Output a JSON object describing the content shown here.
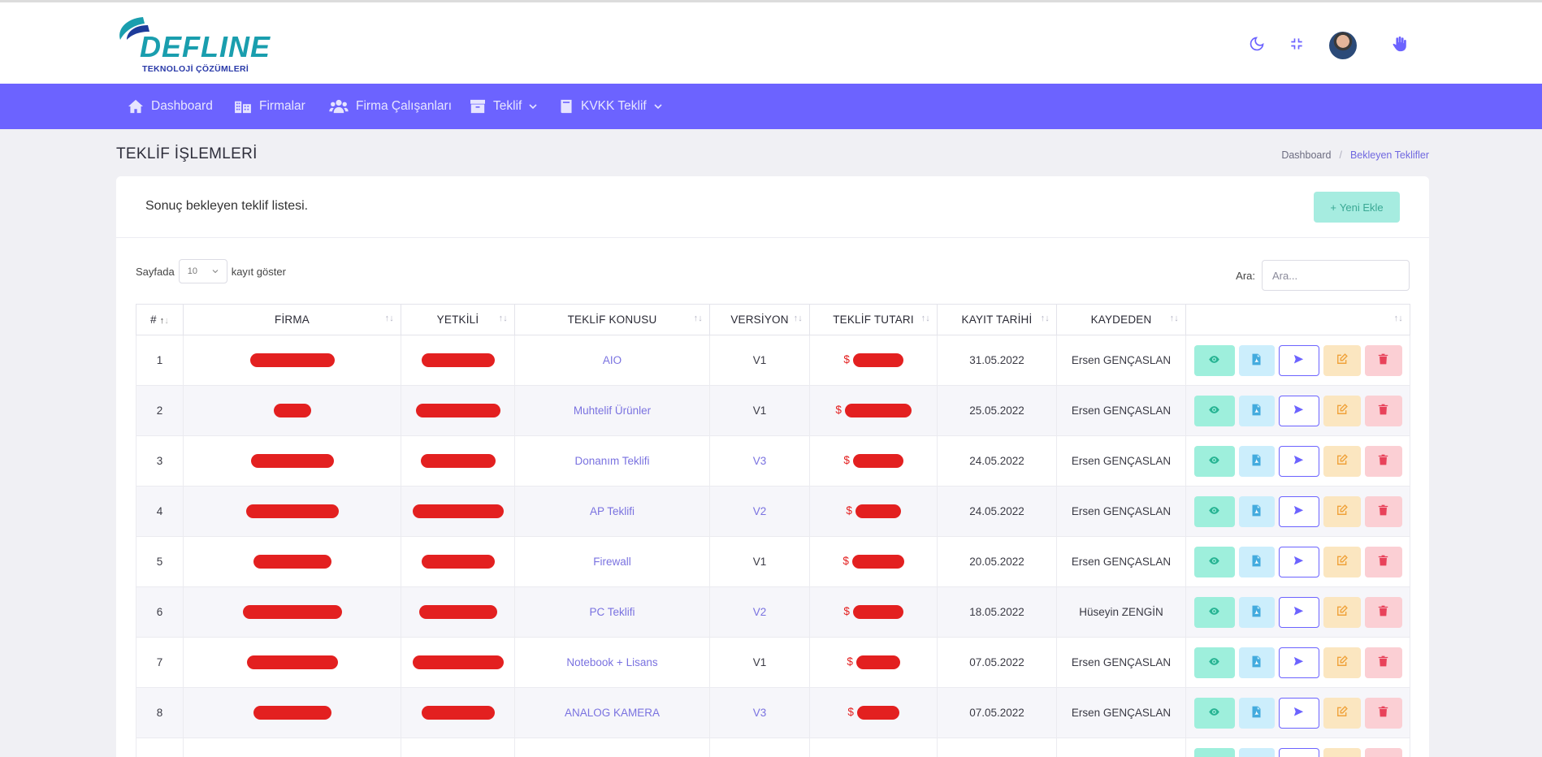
{
  "header": {
    "logo_text": "DEFLINE",
    "logo_subtitle": "TEKNOLOJİ ÇÖZÜMLERİ",
    "icons": [
      "moon-icon",
      "minimize-icon",
      "avatar",
      "hand-icon"
    ]
  },
  "nav": {
    "items": [
      {
        "label": "Dashboard",
        "icon": "home-icon"
      },
      {
        "label": "Firmalar",
        "icon": "building-icon"
      },
      {
        "label": "Firma Çalışanları",
        "icon": "users-icon"
      },
      {
        "label": "Teklif",
        "icon": "archive-icon",
        "dropdown": true
      },
      {
        "label": "KVKK Teklif",
        "icon": "book-icon",
        "dropdown": true
      }
    ],
    "bg_color": "#6c63ff"
  },
  "page": {
    "title": "TEKLİF İŞLEMLERİ",
    "breadcrumb": [
      "Dashboard",
      "Bekleyen Teklifler"
    ]
  },
  "card": {
    "title": "Sonuç bekleyen teklif listesi.",
    "new_button": "Yeni Ekle",
    "length_prefix": "Sayfada",
    "length_value": "10",
    "length_suffix": "kayıt göster",
    "search_label": "Ara:",
    "search_placeholder": "Ara..."
  },
  "table": {
    "columns": [
      "#",
      "FİRMA",
      "YETKİLİ",
      "TEKLİF KONUSU",
      "VERSİYON",
      "TEKLİF TUTARI",
      "KAYIT TARİHİ",
      "KAYDEDEN",
      ""
    ],
    "rows": [
      {
        "no": "1",
        "konu": "AIO",
        "versiyon": "V1",
        "tarih": "31.05.2022",
        "kaydeden": "Ersen GENÇASLAN"
      },
      {
        "no": "2",
        "konu": "Muhtelif Ürünler",
        "versiyon": "V1",
        "tarih": "25.05.2022",
        "kaydeden": "Ersen GENÇASLAN"
      },
      {
        "no": "3",
        "konu": "Donanım Teklifi",
        "versiyon": "V3",
        "tarih": "24.05.2022",
        "kaydeden": "Ersen GENÇASLAN"
      },
      {
        "no": "4",
        "konu": "AP Teklifi",
        "versiyon": "V2",
        "tarih": "24.05.2022",
        "kaydeden": "Ersen GENÇASLAN"
      },
      {
        "no": "5",
        "konu": "Firewall",
        "versiyon": "V1",
        "tarih": "20.05.2022",
        "kaydeden": "Ersen GENÇASLAN"
      },
      {
        "no": "6",
        "konu": "PC Teklifi",
        "versiyon": "V2",
        "tarih": "18.05.2022",
        "kaydeden": "Hüseyin ZENGİN"
      },
      {
        "no": "7",
        "konu": "Notebook + Lisans",
        "versiyon": "V1",
        "tarih": "07.05.2022",
        "kaydeden": "Ersen GENÇASLAN"
      },
      {
        "no": "8",
        "konu": "ANALOG KAMERA",
        "versiyon": "V3",
        "tarih": "07.05.2022",
        "kaydeden": "Ersen GENÇASLAN"
      }
    ],
    "currency_symbol": "$",
    "redaction_color": "#e32020",
    "action_icons": [
      "eye-icon",
      "pdf-icon",
      "send-icon",
      "edit-icon",
      "trash-icon"
    ]
  }
}
